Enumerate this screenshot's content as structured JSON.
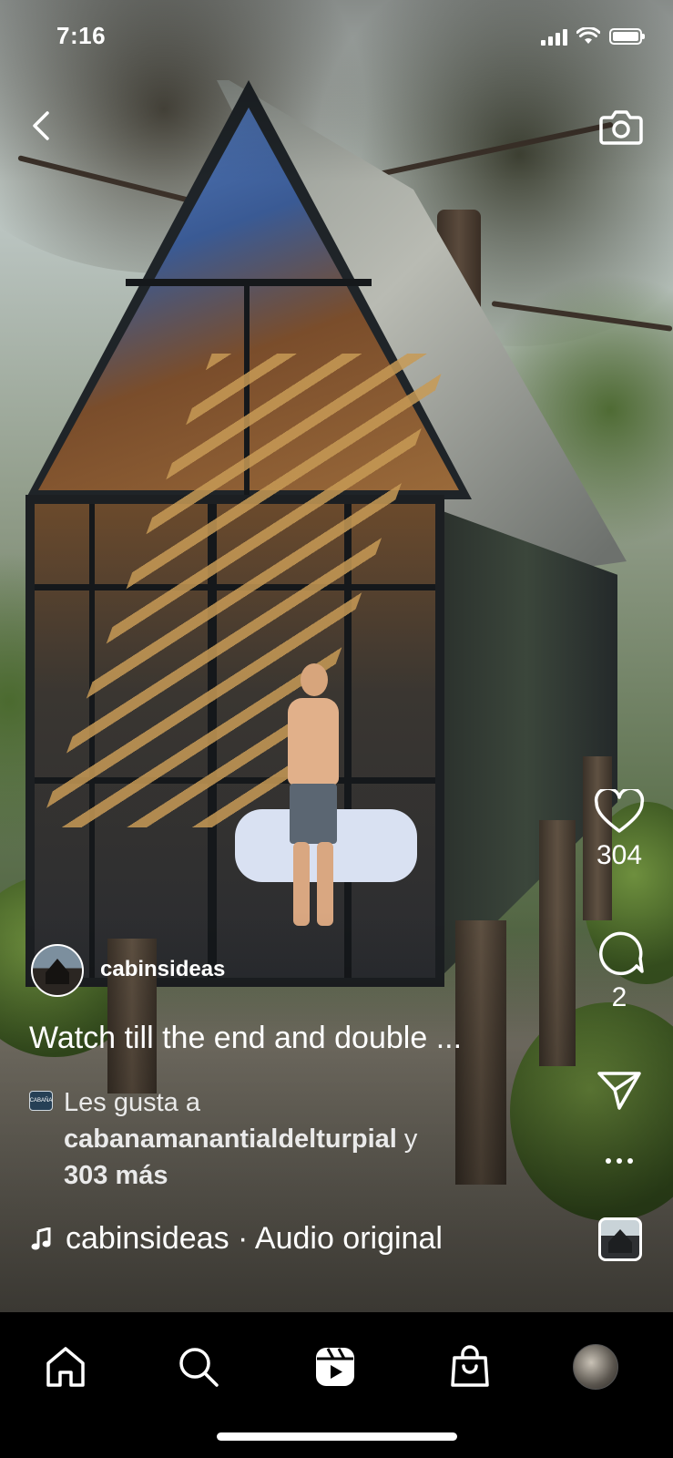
{
  "status_bar": {
    "time": "7:16"
  },
  "post": {
    "username": "cabinsideas",
    "caption": "Watch till the end and double ...",
    "likes": {
      "prefix": "Les gusta a",
      "first_user": "cabanamanantialdelturpial",
      "connector": "y",
      "others": "303 más",
      "badge_text": "CABAÑA"
    },
    "audio": {
      "label": "cabinsideas · Audio original"
    }
  },
  "actions": {
    "like_count": "304",
    "comment_count": "2"
  },
  "icons": {
    "back": "chevron-left-icon",
    "camera": "camera-icon",
    "like": "heart-icon",
    "comment": "comment-bubble-icon",
    "share": "paper-plane-icon",
    "more": "more-dots-icon",
    "music": "music-note-icon",
    "nav": [
      "home-icon",
      "search-icon",
      "reels-icon",
      "shop-bag-icon",
      "profile-avatar"
    ]
  },
  "colors": {
    "nav_background": "#000000",
    "text": "#ffffff"
  }
}
